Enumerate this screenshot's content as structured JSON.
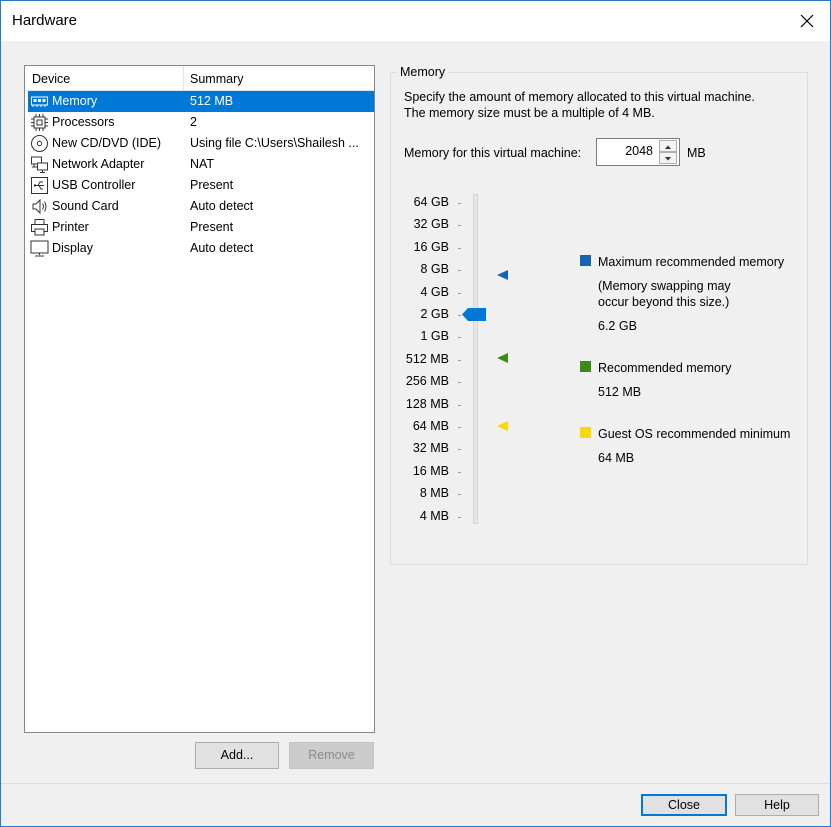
{
  "window": {
    "title": "Hardware"
  },
  "devices": {
    "header": {
      "device": "Device",
      "summary": "Summary"
    },
    "items": [
      {
        "name": "Memory",
        "summary": "512 MB",
        "icon": "memory-icon"
      },
      {
        "name": "Processors",
        "summary": "2",
        "icon": "processor-icon"
      },
      {
        "name": "New CD/DVD (IDE)",
        "summary": "Using file C:\\Users\\Shailesh ...",
        "icon": "cd-dvd-icon"
      },
      {
        "name": "Network Adapter",
        "summary": "NAT",
        "icon": "network-icon"
      },
      {
        "name": "USB Controller",
        "summary": "Present",
        "icon": "usb-icon"
      },
      {
        "name": "Sound Card",
        "summary": "Auto detect",
        "icon": "speaker-icon"
      },
      {
        "name": "Printer",
        "summary": "Present",
        "icon": "printer-icon"
      },
      {
        "name": "Display",
        "summary": "Auto detect",
        "icon": "monitor-icon"
      }
    ],
    "selected": 0
  },
  "buttons": {
    "add": "Add...",
    "remove": "Remove",
    "close": "Close",
    "help": "Help"
  },
  "memory": {
    "group_title": "Memory",
    "description_line1": "Specify the amount of memory allocated to this virtual machine.",
    "description_line2": "The memory size must be a multiple of 4 MB.",
    "field_label": "Memory for this virtual machine:",
    "value": "2048",
    "unit": "MB",
    "scale": [
      "64 GB",
      "32 GB",
      "16 GB",
      "8 GB",
      "4 GB",
      "2 GB",
      "1 GB",
      "512 MB",
      "256 MB",
      "128 MB",
      "64 MB",
      "32 MB",
      "16 MB",
      "8 MB",
      "4 MB"
    ],
    "legend": {
      "max": {
        "title": "Maximum recommended memory",
        "note_line1": "(Memory swapping may",
        "note_line2": "occur beyond this size.)",
        "value": "6.2 GB",
        "color": "#1565b0"
      },
      "recommended": {
        "title": "Recommended memory",
        "value": "512 MB",
        "color": "#3d8b15"
      },
      "guest_min": {
        "title": "Guest OS recommended minimum",
        "value": "64 MB",
        "color": "#f5d90a"
      }
    },
    "slider_color": "#0078d7"
  }
}
